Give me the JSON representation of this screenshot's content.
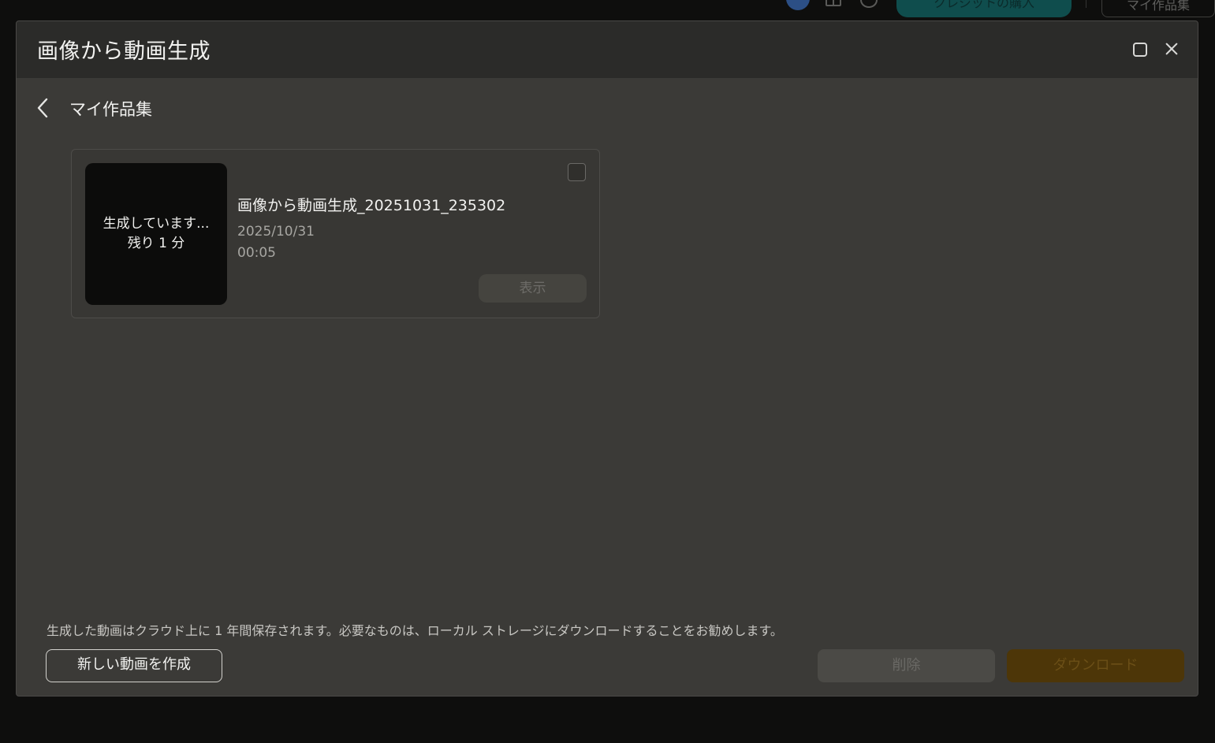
{
  "background_app": {
    "credit_button_label": "クレジットの購入",
    "works_button_label": "マイ作品集"
  },
  "dialog": {
    "title": "画像から動画生成"
  },
  "section": {
    "title": "マイ作品集"
  },
  "works": [
    {
      "status_line1": "生成しています...",
      "status_line2": "残り 1 分",
      "name": "画像から動画生成_20251031_235302",
      "date": "2025/10/31",
      "duration": "00:05",
      "view_label": "表示",
      "checked": false
    }
  ],
  "footer": {
    "notice": "生成した動画はクラウド上に 1 年間保存されます。必要なものは、ローカル ストレージにダウンロードすることをお勧めします。",
    "new_video_label": "新しい動画を作成",
    "delete_label": "削除",
    "download_label": "ダウンロード"
  },
  "colors": {
    "dialog_bg": "#3b3a37",
    "titlebar_bg": "#2b2b29",
    "download_disabled": "#4d3608",
    "credit_button": "#0f4d4d"
  }
}
